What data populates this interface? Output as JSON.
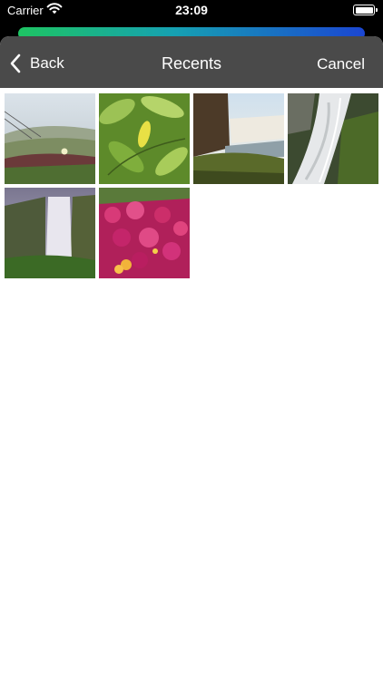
{
  "status_bar": {
    "carrier": "Carrier",
    "time": "23:09"
  },
  "nav": {
    "back_label": "Back",
    "title": "Recents",
    "cancel_label": "Cancel"
  },
  "colors": {
    "nav_background": "#4a4a4a",
    "gradient": [
      "#1ec463",
      "#16a1b2",
      "#1b46d2"
    ]
  },
  "photos": [
    {
      "subject": "coastal-iceplant-meadow"
    },
    {
      "subject": "lemon-tree-leaves"
    },
    {
      "subject": "waterfall-canyon-mist"
    },
    {
      "subject": "waterfall-long-exposure"
    },
    {
      "subject": "skogafoss-waterfall"
    },
    {
      "subject": "magenta-flower-bed"
    }
  ]
}
